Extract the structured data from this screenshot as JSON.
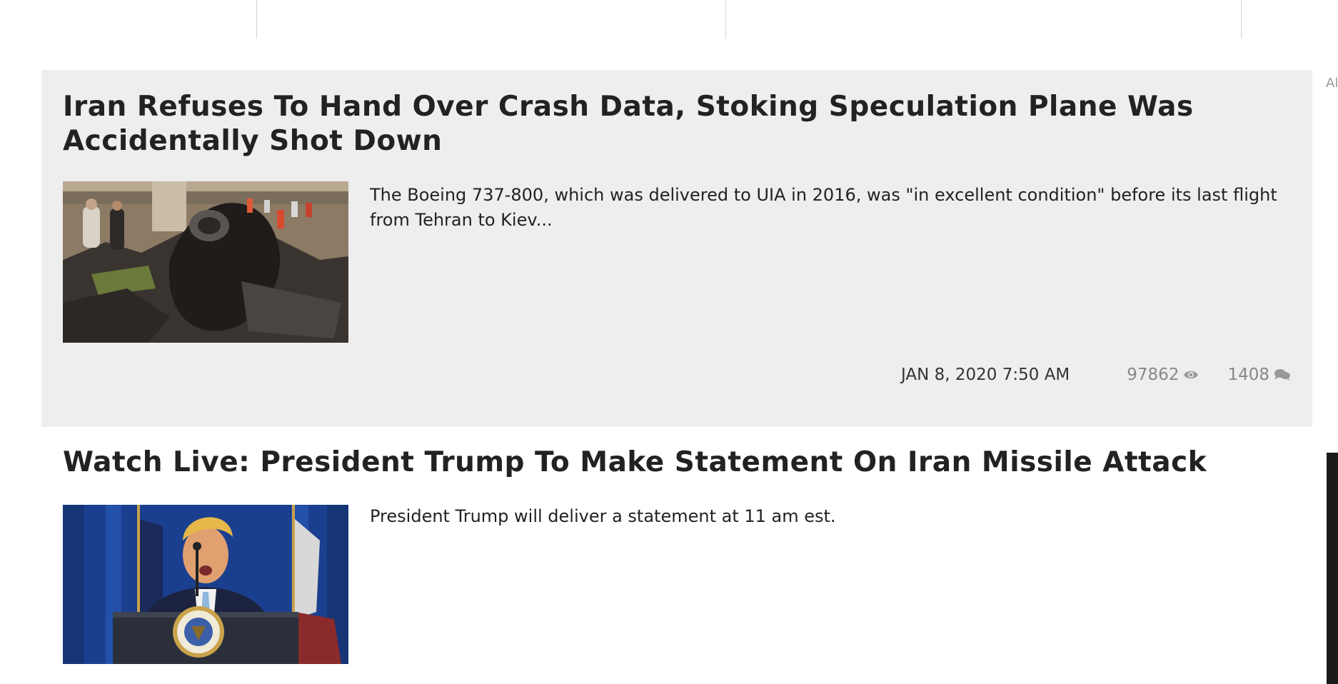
{
  "side_label": "Al",
  "articles": [
    {
      "title": "Iran Refuses To Hand Over Crash Data, Stoking Speculation Plane Was Accidentally Shot Down",
      "summary": "The Boeing 737-800, which was delivered to UIA in 2016, was \"in excellent condition\" before its last flight from Tehran to Kiev...",
      "date": "JAN 8, 2020 7:50 AM",
      "views": "97862",
      "comments": "1408",
      "thumbnail": "plane-crash-wreckage-photo",
      "view_icon": "eye-icon",
      "comment_icon": "comments-icon"
    },
    {
      "title": "Watch Live: President Trump To Make Statement On Iran Missile Attack",
      "summary": "President Trump will deliver a statement at 11 am est.",
      "thumbnail": "president-at-podium-photo"
    }
  ],
  "colors": {
    "featured_background": "#eeeeee",
    "headline_text": "#222222",
    "meta_muted": "#888888"
  }
}
